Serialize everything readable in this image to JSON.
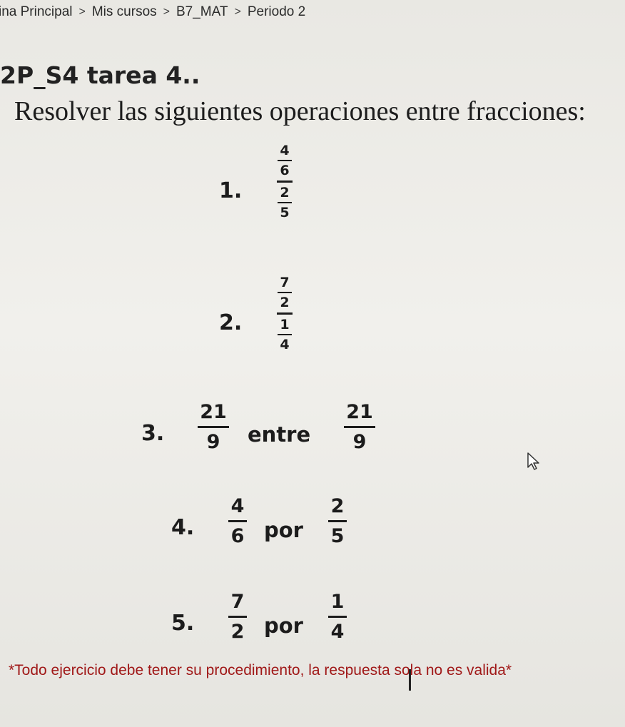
{
  "breadcrumb": {
    "items": [
      "ina Principal",
      "Mis cursos",
      "B7_MAT",
      "Periodo 2"
    ],
    "separator": ">"
  },
  "page_title": "2P_S4 tarea 4..",
  "instructions": "Resolver las siguientes operaciones entre fracciones:",
  "exercises": [
    {
      "number": "1.",
      "top": {
        "num": "4",
        "den": "6"
      },
      "bottom": {
        "num": "2",
        "den": "5"
      }
    },
    {
      "number": "2.",
      "top": {
        "num": "7",
        "den": "2"
      },
      "bottom": {
        "num": "1",
        "den": "4"
      }
    },
    {
      "number": "3.",
      "left": {
        "num": "21",
        "den": "9"
      },
      "word": "entre",
      "right": {
        "num": "21",
        "den": "9"
      }
    },
    {
      "number": "4.",
      "left": {
        "num": "4",
        "den": "6"
      },
      "word": "por",
      "right": {
        "num": "2",
        "den": "5"
      }
    },
    {
      "number": "5.",
      "left": {
        "num": "7",
        "den": "2"
      },
      "word": "por",
      "right": {
        "num": "1",
        "den": "4"
      }
    }
  ],
  "note": "*Todo ejercicio debe tener su procedimiento, la respuesta sola no es valida*",
  "colors": {
    "note": "#a01818",
    "text": "#1c1c1c",
    "background": "#eceae5"
  }
}
